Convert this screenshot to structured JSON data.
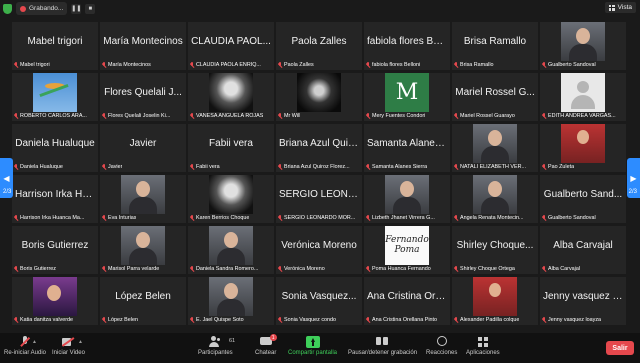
{
  "topbar": {
    "recording_label": "Grabando...",
    "view_label": "Vista"
  },
  "pagination": {
    "left": "2/3",
    "right": "2/3"
  },
  "tiles": [
    {
      "big": "Mabel trigori",
      "label": "Mabel trigori"
    },
    {
      "big": "María Montecinos",
      "label": "María Montecinos"
    },
    {
      "big": "CLAUDIA PAOL...",
      "label": "CLAUDIA PAOLA ENRIQ..."
    },
    {
      "big": "Paola Zalles",
      "label": "Paola Zalles"
    },
    {
      "big": "fabiola flores Be...",
      "label": "fabiola flores Belloni"
    },
    {
      "big": "Brisa Ramallo",
      "label": "Brisa Ramallo"
    },
    {
      "photo": "person",
      "label": "Gualberto Sandoval"
    },
    {
      "photo": "sky",
      "label": "ROBERTO CARLOS ARA..."
    },
    {
      "big": "Flores Quelali J...",
      "label": "Flores Quelali Joselin Ki..."
    },
    {
      "photo": "bw",
      "label": "VANESA ANGUELA ROJAS"
    },
    {
      "photo": "dark",
      "label": "Mr Will"
    },
    {
      "photo": "green",
      "photo_text": "M",
      "label": "Mery Fuentes Condori"
    },
    {
      "big": "Mariel Rossel G...",
      "label": "Mariel Rossel Guarayo"
    },
    {
      "photo": "avatar",
      "label": "EDITH ANDREA VARGAS..."
    },
    {
      "big": "Daniela Hualuque",
      "label": "Daniela Hualuque"
    },
    {
      "big": "Javier",
      "label": "Javier"
    },
    {
      "big": "Fabii vera",
      "label": "Fabii vera"
    },
    {
      "big": "Briana Azul Quir...",
      "label": "Briana Azul Quiroz Florez..."
    },
    {
      "big": "Samanta Alanes...",
      "label": "Samanta Alanes Sierra"
    },
    {
      "photo": "person",
      "label": "NATALI ELIZABETH VER..."
    },
    {
      "photo": "red",
      "label": "Pao Zuleta"
    },
    {
      "big": "Harrison Irka Hu...",
      "label": "Harrison Irka Huanca Ma..."
    },
    {
      "photo": "person",
      "label": "Eva Inturias"
    },
    {
      "photo": "bw",
      "label": "Karen Berrios Choque"
    },
    {
      "big": "SERGIO LEONA...",
      "label": "SERGIO LEONARDO MOR..."
    },
    {
      "photo": "person",
      "label": "Lizbeth Jhanet Virrera G..."
    },
    {
      "photo": "person",
      "label": "Angela Renata Montecin..."
    },
    {
      "big": "Gualberto Sand...",
      "label": "Gualberto Sandoval"
    },
    {
      "big": "Boris Gutierrez",
      "label": "Boris Gutierrez"
    },
    {
      "photo": "person",
      "label": "Marisol Parra velarde"
    },
    {
      "photo": "person",
      "label": "Daniela Sandra Romero..."
    },
    {
      "big": "Verónica Moreno",
      "label": "Verónica Moreno"
    },
    {
      "photo": "logo",
      "photo_text": "Fernando Poma",
      "label": "Poma Huanca Fernando"
    },
    {
      "big": "Shirley Choque...",
      "label": "Shirley Choque Ortega"
    },
    {
      "big": "Alba Carvajal",
      "label": "Alba Carvajal"
    },
    {
      "photo": "purple",
      "label": "Katia danitza valverde"
    },
    {
      "big": "López Belen",
      "label": "López Belen"
    },
    {
      "photo": "person",
      "label": "E. Jael Quispe Soto"
    },
    {
      "big": "Sonia Vasquez...",
      "label": "Sonia Vasquez condo"
    },
    {
      "big": "Ana Cristina Ore...",
      "label": "Ana Cristina Orellana Pinto"
    },
    {
      "photo": "red",
      "label": "Alexander Padilla colque"
    },
    {
      "big": "Jenny vasquez l...",
      "label": "Jenny vasquez loayza"
    }
  ],
  "toolbar": {
    "unmute": "Re-iniciar Audio",
    "start_video": "Iniciar Video",
    "participants": "Participantes",
    "participants_count": "61",
    "chat": "Chatear",
    "chat_badge": "1",
    "share": "Compartir pantalla",
    "record": "Pausar/detener grabación",
    "reactions": "Reacciones",
    "apps": "Aplicaciones",
    "leave": "Salir"
  },
  "colors": {
    "accent": "#2d8cff",
    "leave": "#e5484d",
    "share": "#3ecf5a",
    "tile_bg": "#252525"
  }
}
